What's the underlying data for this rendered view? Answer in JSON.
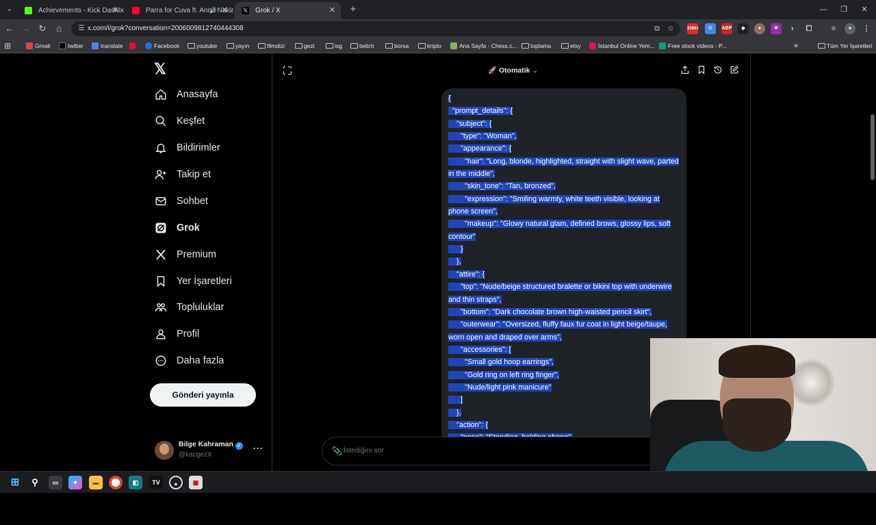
{
  "browser": {
    "tabs": [
      {
        "title": "Achievements - Kick Dashboard",
        "favicon_color": "#53fc18"
      },
      {
        "title": "Parra for Cuva ft. Anna Naklab",
        "favicon_color": "#ff0033"
      },
      {
        "title": "Grok / X",
        "favicon_color": "#000000"
      }
    ],
    "url": "x.com/i/grok?conversation=2006009812740444308",
    "ext_badge": "23951",
    "ext_abp": "ABP",
    "bookmarks": [
      {
        "label": "Gmail",
        "type": "site",
        "color": "#ea4335"
      },
      {
        "label": "twitter",
        "type": "site",
        "color": "#000000"
      },
      {
        "label": "translate",
        "type": "site",
        "color": "#4285f4"
      },
      {
        "label": "Facebook",
        "type": "site",
        "color": "#1877f2"
      },
      {
        "label": "youtube",
        "type": "folder"
      },
      {
        "label": "yayın",
        "type": "folder"
      },
      {
        "label": "filmdizi",
        "type": "folder"
      },
      {
        "label": "gezi",
        "type": "folder"
      },
      {
        "label": "isg",
        "type": "folder"
      },
      {
        "label": "twitch",
        "type": "folder"
      },
      {
        "label": "borsa",
        "type": "folder"
      },
      {
        "label": "kripto",
        "type": "folder"
      },
      {
        "label": "Ana Sayfa - Chess.c...",
        "type": "site",
        "color": "#81b64c"
      },
      {
        "label": "toplama",
        "type": "folder"
      },
      {
        "label": "etsy",
        "type": "folder"
      },
      {
        "label": "İstanbul Online Yem...",
        "type": "site",
        "color": "#e3104d"
      },
      {
        "label": "Free stock videos - P...",
        "type": "site",
        "color": "#05a081"
      }
    ],
    "all_bookmarks": "Tüm Yer İşaretleri"
  },
  "sidebar": {
    "items": [
      {
        "label": "Anasayfa",
        "icon": "home-icon"
      },
      {
        "label": "Keşfet",
        "icon": "search-icon"
      },
      {
        "label": "Bildirimler",
        "icon": "bell-icon"
      },
      {
        "label": "Takip et",
        "icon": "follow-icon"
      },
      {
        "label": "Sohbet",
        "icon": "mail-icon"
      },
      {
        "label": "Grok",
        "icon": "grok-icon"
      },
      {
        "label": "Premium",
        "icon": "x-premium-icon"
      },
      {
        "label": "Yer İşaretleri",
        "icon": "bookmark-icon"
      },
      {
        "label": "Topluluklar",
        "icon": "communities-icon"
      },
      {
        "label": "Profil",
        "icon": "profile-icon"
      },
      {
        "label": "Daha fazla",
        "icon": "more-icon"
      }
    ],
    "post_button": "Gönderi yayınla",
    "user": {
      "name": "Bilge Kahraman",
      "handle": "@kacgezX"
    }
  },
  "grok": {
    "mode": "Otomatik",
    "ask_placeholder": "İstediğini sor",
    "message_lines": [
      "{",
      "  \"prompt_details\": {",
      "    \"subject\": {",
      "      \"type\": \"Woman\",",
      "      \"appearance\": {",
      "        \"hair\": \"Long, blonde, highlighted, straight with slight wave, parted",
      "in the middle\",",
      "        \"skin_tone\": \"Tan, bronzed\",",
      "        \"expression\": \"Smiling warmly, white teeth visible, looking at",
      "phone screen\",",
      "        \"makeup\": \"Glowy natural glam, defined brows, glossy lips, soft",
      "contour\"",
      "      }",
      "    },",
      "    \"attire\": {",
      "      \"top\": \"Nude/beige structured bralette or bikini top with underwire",
      "and thin straps\",",
      "      \"bottom\": \"Dark chocolate brown high-waisted pencil skirt\",",
      "      \"outerwear\": \"Oversized, fluffy faux fur coat in light beige/taupe,",
      "worn open and draped over arms\",",
      "      \"accessories\": [",
      "        \"Small gold hoop earrings\",",
      "        \"Gold ring on left ring finger\",",
      "        \"Nude/light pink manicure\"",
      "      ]",
      "    },",
      "    \"action\": {",
      "      \"pose\": \"Standing, holding phone\","
    ]
  },
  "colors": {
    "selection": "#1f46b9",
    "bubble": "#1f2226",
    "accent": "#1d9bf0"
  }
}
